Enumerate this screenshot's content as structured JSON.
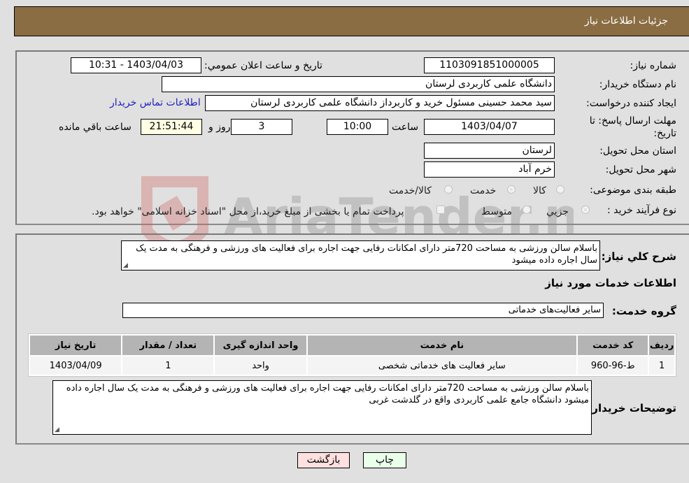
{
  "header": {
    "title": "جزئیات اطلاعات نیاز"
  },
  "form": {
    "need_number": {
      "label": "شماره نیاز:",
      "value": "1103091851000005"
    },
    "announce_datetime": {
      "label": "تاریخ و ساعت اعلان عمومي:",
      "value": "1403/04/03 - 10:31"
    },
    "buyer_org": {
      "label": "نام دستگاه خریدار:",
      "value": "دانشگاه علمی کاربردی لرستان"
    },
    "requester": {
      "label": "ایجاد کننده درخواست:",
      "value": "سید محمد حسینی مسئول خرید و کاربرداز دانشگاه علمی کاربردی لرستان"
    },
    "contact_link": "اطلاعات تماس خریدار",
    "deadline": {
      "label": "مهلت ارسال پاسخ: تا تاریخ:",
      "date": "1403/04/07",
      "time_label": "ساعت",
      "time": "10:00",
      "days": "3",
      "days_label": "روز و",
      "remaining": "21:51:44",
      "remaining_label": "ساعت باقي مانده"
    },
    "province": {
      "label": "استان محل تحویل:",
      "value": "لرستان"
    },
    "city": {
      "label": "شهر محل تحویل:",
      "value": "خرم آباد"
    },
    "category": {
      "label": "طبقه بندی موضوعی:",
      "options": [
        {
          "label": "کالا",
          "checked": false
        },
        {
          "label": "خدمت",
          "checked": true
        },
        {
          "label": "کالا/خدمت",
          "checked": false
        }
      ]
    },
    "process": {
      "label": "نوع فرآیند خرید :",
      "options": [
        {
          "label": "جزيي",
          "checked": true
        },
        {
          "label": "متوسط",
          "checked": false
        }
      ],
      "treasury_checkbox": {
        "label": "پرداخت تمام یا بخشی از مبلغ خرید،از محل \"اسناد خزانه اسلامی\" خواهد بود.",
        "checked": false
      }
    }
  },
  "details": {
    "description_label": "شرح کلي نیاز:",
    "description": "باسلام سالن ورزشی به مساحت 720متر دارای امکانات رفایی جهت اجاره برای فعالیت های ورزشی و فرهنگی به مدت یک سال اجاره داده میشود",
    "services_heading": "اطلاعات خدمات مورد نیاز",
    "service_group_label": "گروه خدمت:",
    "service_group": "سایر فعالیت‌های خدماتی",
    "table": {
      "headers": [
        "ردیف",
        "کد خدمت",
        "نام خدمت",
        "واحد اندازه گیری",
        "تعداد / مقدار",
        "تاریخ نیاز"
      ],
      "rows": [
        [
          "1",
          "ط-96-960",
          "سایر فعالیت های خدماتی شخصی",
          "واحد",
          "1",
          "1403/04/09"
        ]
      ]
    },
    "buyer_notes_label": "توضیحات خریدار:",
    "buyer_notes": "باسلام سالن ورزشی به مساحت 720متر دارای امکانات رفایی جهت اجاره برای فعالیت های ورزشی و فرهنگی به مدت یک سال اجاره داده میشود دانشگاه جامع علمی کاربردی واقع در گلدشت غربی"
  },
  "buttons": {
    "print": "چاپ",
    "back": "بازگشت"
  },
  "watermark": {
    "text": "AriaTender.neT"
  },
  "colors": {
    "header_bg": "#8b6d43",
    "link": "#2020c0",
    "print_bg": "#eaffea",
    "back_bg": "#ffe0e0",
    "remaining_bg": "#ffffe4"
  }
}
